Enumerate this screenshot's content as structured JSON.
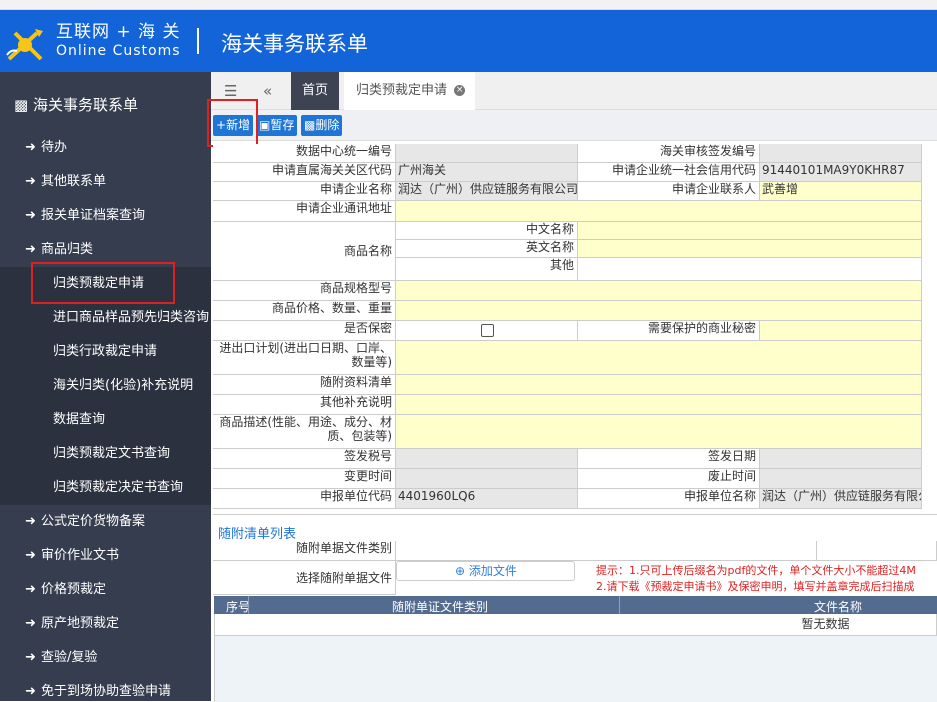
{
  "header": {
    "brand_cn": "互联网 + 海 关",
    "brand_en": "Online Customs",
    "title": "海关事务联系单"
  },
  "sidebar": {
    "title": "海关事务联系单",
    "items_top": [
      "待办",
      "其他联系单",
      "报关单证档案查询",
      "商品归类"
    ],
    "sub_items": [
      "归类预裁定申请",
      "进口商品样品预先归类咨询",
      "归类行政裁定申请",
      "海关归类(化验)补充说明",
      "数据查询",
      "归类预裁定文书查询",
      "归类预裁定决定书查询"
    ],
    "items_bottom": [
      "公式定价货物备案",
      "审价作业文书",
      "价格预裁定",
      "原产地预裁定",
      "查验/复验",
      "免于到场协助查验申请"
    ]
  },
  "tabs": {
    "home": "首页",
    "current": "归类预裁定申请"
  },
  "toolbar": {
    "add": "新增",
    "save": "暂存",
    "delete": "删除"
  },
  "form": {
    "l_data_center_no": "数据中心统一编号",
    "l_customs_sign_no": "海关审核签发编号",
    "l_direct_customs": "申请直属海关关区代码",
    "v_direct_customs": "广州海关",
    "l_credit_code": "申请企业统一社会信用代码",
    "v_credit_code": "91440101MA9Y0KHR87",
    "l_company_name": "申请企业名称",
    "v_company_name": "润达（广州）供应链服务有限公司",
    "l_contact": "申请企业联系人",
    "v_contact": "武善增",
    "l_address": "申请企业通讯地址",
    "l_goods_name": "商品名称",
    "l_cn_name": "中文名称",
    "l_en_name": "英文名称",
    "l_other": "其他",
    "l_spec": "商品规格型号",
    "l_price_qty": "商品价格、数量、重量",
    "l_confidential": "是否保密",
    "l_trade_secret": "需要保护的商业秘密",
    "l_plan_1": "进出口计划(进出口日期、口岸、",
    "l_plan_2": "数量等)",
    "l_attach_list": "随附资料清单",
    "l_other_note": "其他补充说明",
    "l_desc_1": "商品描述(性能、用途、成分、材",
    "l_desc_2": "质、包装等)",
    "l_tax_no": "签发税号",
    "l_sign_date": "签发日期",
    "l_change_time": "变更时间",
    "l_void_time": "废止时间",
    "l_declarer_code": "申报单位代码",
    "v_declarer_code": "4401960LQ6",
    "l_declarer_name": "申报单位名称",
    "v_declarer_name": "润达（广州）供应链服务有限公司"
  },
  "attachments": {
    "title": "随附清单列表",
    "l_doc_type": "随附单据文件类别",
    "l_select_file": "选择随附单据文件",
    "add_file": "添加文件",
    "tip_1": "提示：1.只可上传后缀名为pdf的文件，单个文件大小不能超过4M",
    "tip_2": "2.请下载《预裁定申请书》及保密申明，填写并盖章完成后扫描成",
    "col_no": "序号",
    "col_type": "随附单证文件类别",
    "col_name": "文件名称",
    "empty": "暂无数据"
  }
}
